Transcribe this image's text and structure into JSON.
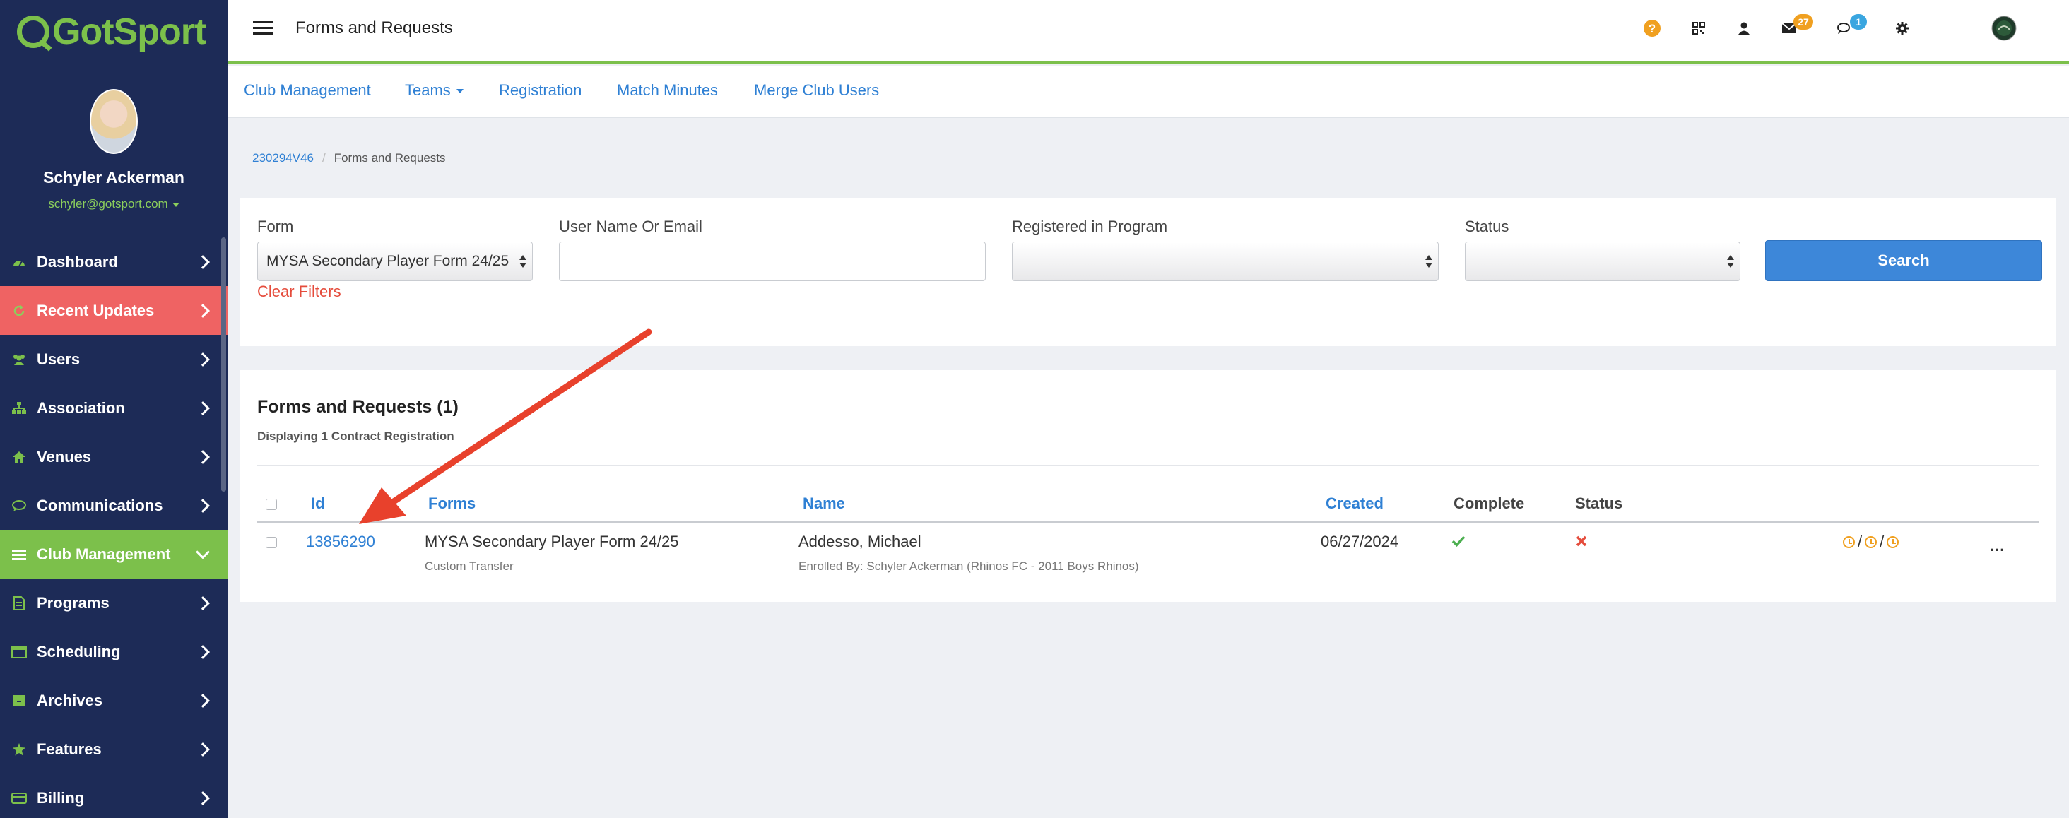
{
  "app": {
    "logo_text": "GotSport",
    "brand_color": "#7cc04b",
    "sidebar_color": "#1d2b57"
  },
  "profile": {
    "name": "Schyler Ackerman",
    "email": "schyler@gotsport.com"
  },
  "sidebar": {
    "items": [
      {
        "label": "Dashboard",
        "icon": "dashboard-icon",
        "state": "normal"
      },
      {
        "label": "Recent Updates",
        "icon": "refresh-icon",
        "state": "highlight"
      },
      {
        "label": "Users",
        "icon": "users-icon",
        "state": "normal"
      },
      {
        "label": "Association",
        "icon": "sitemap-icon",
        "state": "normal"
      },
      {
        "label": "Venues",
        "icon": "home-icon",
        "state": "normal"
      },
      {
        "label": "Communications",
        "icon": "chat-icon",
        "state": "normal"
      },
      {
        "label": "Club Management",
        "icon": "list-icon",
        "state": "active"
      },
      {
        "label": "Programs",
        "icon": "document-icon",
        "state": "normal"
      },
      {
        "label": "Scheduling",
        "icon": "calendar-icon",
        "state": "normal"
      },
      {
        "label": "Archives",
        "icon": "archive-icon",
        "state": "normal"
      },
      {
        "label": "Features",
        "icon": "star-icon",
        "state": "normal"
      },
      {
        "label": "Billing",
        "icon": "credit-card-icon",
        "state": "normal"
      }
    ]
  },
  "topbar": {
    "title": "Forms and Requests",
    "mail_badge": "27",
    "chat_badge": "1",
    "mail_badge_color": "#f0a020",
    "chat_badge_color": "#3aa6e0"
  },
  "subnav": {
    "club_management": "Club Management",
    "teams": "Teams",
    "registration": "Registration",
    "match_minutes": "Match Minutes",
    "merge_club_users": "Merge Club Users"
  },
  "breadcrumb": {
    "root": "230294V46",
    "current": "Forms and Requests"
  },
  "filters": {
    "form_label": "Form",
    "form_value": "MYSA Secondary Player Form 24/25",
    "user_label": "User Name Or Email",
    "user_value": "",
    "program_label": "Registered in Program",
    "program_value": "",
    "status_label": "Status",
    "status_value": "",
    "clear_label": "Clear Filters",
    "search_label": "Search"
  },
  "results": {
    "title": "Forms and Requests (1)",
    "subtitle": "Displaying 1 Contract Registration",
    "columns": {
      "id": "Id",
      "forms": "Forms",
      "name": "Name",
      "created": "Created",
      "complete": "Complete",
      "status": "Status"
    },
    "rows": [
      {
        "id": "13856290",
        "form": "MYSA Secondary Player Form 24/25",
        "form_type": "Custom Transfer",
        "name": "Addesso, Michael",
        "enrolled_by": "Enrolled By: Schyler Ackerman (Rhinos FC - 2011 Boys Rhinos)",
        "created": "06/27/2024",
        "complete": "check",
        "status": "x",
        "separator": "/",
        "menu": "..."
      }
    ]
  },
  "annotation": {
    "arrow_color": "#e8412c"
  }
}
